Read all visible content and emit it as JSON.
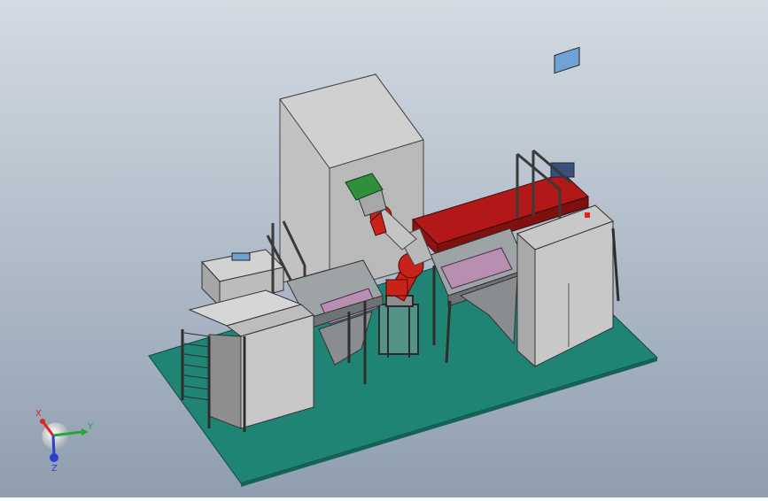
{
  "viewport": {
    "background_top": "#d3dbe3",
    "background_bottom": "#8f9eb0"
  },
  "colors": {
    "floor_plate": "#1f8474",
    "cabinet_light": "#c8c8c8",
    "cabinet_side": "#a9a9a9",
    "tall_enclosure_front": "#c2c2c2",
    "tall_enclosure_side": "#a7a7a7",
    "conveyor_red": "#b21818",
    "robot_red": "#c8221a",
    "gripper_green": "#2f8f3a",
    "screen_blue": "#6fa3d6",
    "frame_dark": "#3a3a3a",
    "tray_pink": "#b78fb0",
    "motor_blue": "#3b4f7a"
  },
  "triad": {
    "x_label": "X",
    "y_label": "Y",
    "z_label": "Z",
    "x_color": "#e0261b",
    "y_color": "#23a63a",
    "z_color": "#2b3fd1"
  }
}
